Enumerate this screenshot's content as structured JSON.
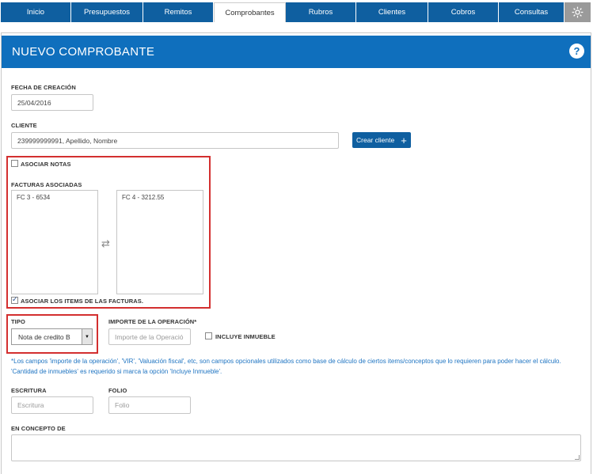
{
  "nav": {
    "items": [
      {
        "label": "Inicio"
      },
      {
        "label": "Presupuestos"
      },
      {
        "label": "Remitos"
      },
      {
        "label": "Comprobantes"
      },
      {
        "label": "Rubros"
      },
      {
        "label": "Clientes"
      },
      {
        "label": "Cobros"
      },
      {
        "label": "Consultas"
      }
    ],
    "active": "Comprobantes",
    "settings_icon": "gear-icon"
  },
  "header": {
    "title": "NUEVO COMPROBANTE",
    "help_label": "?"
  },
  "form": {
    "fecha_label": "FECHA DE CREACIÓN",
    "fecha_value": "25/04/2016",
    "cliente_label": "CLIENTE",
    "cliente_value": "239999999991, Apellido, Nombre",
    "crear_cliente_label": "Crear cliente",
    "asociar_notas_label": "ASOCIAR NOTAS",
    "asociar_notas_checked": false,
    "facturas_label": "FACTURAS ASOCIADAS",
    "facturas_left": [
      "FC 3 - 6534"
    ],
    "facturas_right": [
      "FC 4 - 3212.55"
    ],
    "asociar_items_label": "ASOCIAR LOS ITEMS DE LAS FACTURAS.",
    "asociar_items_checked": true,
    "tipo_label": "TIPO",
    "tipo_value": "Nota de credito B",
    "importe_label": "IMPORTE DE LA OPERACIÓN*",
    "importe_placeholder": "Importe de la Operació",
    "incluye_inmueble_label": "INCLUYE INMUEBLE",
    "note_text": "*Los campos 'importe de la operación', 'VIR', 'Valuación fiscal', etc, son campos opcionales utilizados como base de cálculo de ciertos items/conceptos que lo requieren para poder hacer el cálculo. 'Cantidad de inmuebles' es requerido si marca la opción 'Incluye Inmueble'.",
    "escritura_label": "ESCRITURA",
    "escritura_placeholder": "Escritura",
    "folio_label": "FOLIO",
    "folio_placeholder": "Folio",
    "concepto_label": "EN CONCEPTO DE"
  },
  "colors": {
    "nav": "#0f5fa0",
    "header": "#0f6fbd",
    "highlight": "#d32f2f",
    "note": "#1e74c2"
  }
}
